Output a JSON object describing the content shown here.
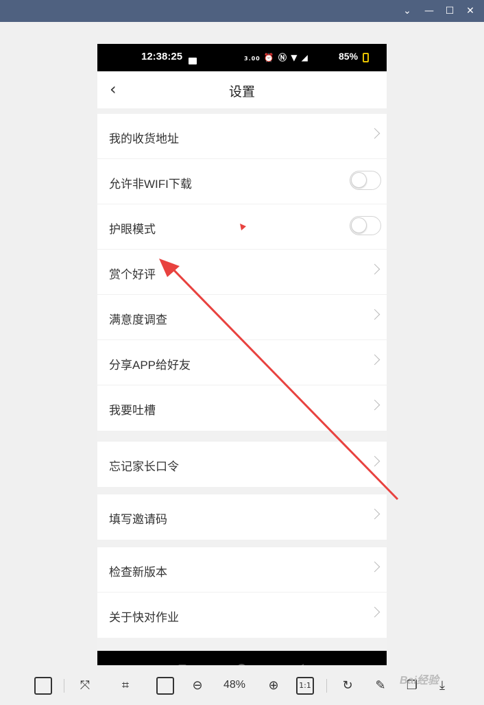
{
  "window": {
    "controls": [
      "chevron-down",
      "minimize",
      "maximize",
      "close"
    ]
  },
  "status_bar": {
    "time": "12:38:25",
    "speed": "3.00",
    "battery": "85%"
  },
  "header": {
    "title": "设置",
    "back_icon": "back-arrow-icon"
  },
  "groups": [
    {
      "items": [
        {
          "label": "我的收货地址",
          "control": "chevron"
        },
        {
          "label": "允许非WIFI下载",
          "control": "toggle",
          "on": false
        },
        {
          "label": "护眼模式",
          "control": "toggle",
          "on": false
        },
        {
          "label": "赏个好评",
          "control": "chevron"
        },
        {
          "label": "满意度调查",
          "control": "chevron"
        },
        {
          "label": "分享APP给好友",
          "control": "chevron"
        },
        {
          "label": "我要吐槽",
          "control": "chevron"
        }
      ]
    },
    {
      "items": [
        {
          "label": "忘记家长口令",
          "control": "chevron"
        }
      ]
    },
    {
      "items": [
        {
          "label": "填写邀请码",
          "control": "chevron"
        }
      ]
    },
    {
      "items": [
        {
          "label": "检查新版本",
          "control": "chevron"
        },
        {
          "label": "关于快对作业",
          "control": "chevron"
        }
      ]
    }
  ],
  "annotation": {
    "color": "#e8423f"
  },
  "toolbar": {
    "zoom": "48%",
    "actual_size": "1:1"
  },
  "watermark": "Bai经验"
}
